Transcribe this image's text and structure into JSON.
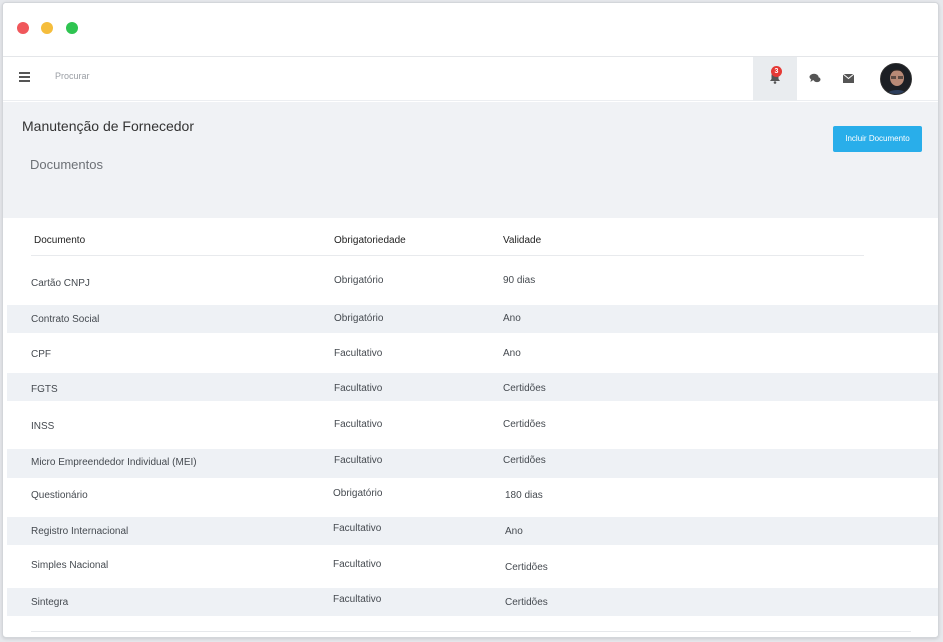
{
  "window": {
    "controls": [
      "close",
      "minimize",
      "maximize"
    ]
  },
  "navbar": {
    "menu_icon": "hamburger-icon",
    "search_placeholder": "Procurar",
    "notifications_count": "3",
    "icons": [
      "bell-icon",
      "chat-icon",
      "mail-icon"
    ]
  },
  "header": {
    "title": "Manutenção de Fornecedor",
    "subtitle": "Documentos",
    "add_button": "Incluir Documento"
  },
  "table": {
    "columns": [
      "Documento",
      "Obrigatoriedade",
      "Validade"
    ],
    "rows": [
      {
        "doc": "Cartão CNPJ",
        "req": "Obrigatório",
        "val": "90 dias"
      },
      {
        "doc": "Contrato Social",
        "req": "Obrigatório",
        "val": "Ano"
      },
      {
        "doc": "CPF",
        "req": "Facultativo",
        "val": "Ano"
      },
      {
        "doc": "FGTS",
        "req": "Facultativo",
        "val": "Certidões"
      },
      {
        "doc": "INSS",
        "req": "Facultativo",
        "val": "Certidões"
      },
      {
        "doc": "Micro Empreendedor Individual (MEI)",
        "req": "Facultativo",
        "val": "Certidões"
      },
      {
        "doc": "Questionário",
        "req": "Obrigatório",
        "val": "180 dias"
      },
      {
        "doc": "Registro Internacional",
        "req": "Facultativo",
        "val": "Ano"
      },
      {
        "doc": "Simples Nacional",
        "req": "Facultativo",
        "val": "Certidões"
      },
      {
        "doc": "Sintegra",
        "req": "Facultativo",
        "val": "Certidões"
      }
    ]
  },
  "colors": {
    "accent": "#29aeea",
    "badge": "#e53935",
    "header_bg": "#f0f2f5",
    "stripe": "#eef1f5"
  }
}
